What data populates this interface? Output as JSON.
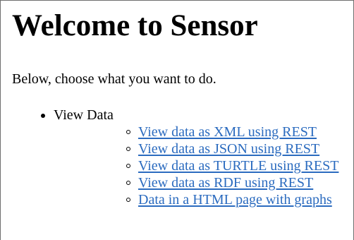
{
  "page": {
    "title": "Welcome to Sensor",
    "intro": "Below, choose what you want to do."
  },
  "menu": {
    "section_label": "View Data",
    "links": [
      {
        "label": "View data as XML using REST"
      },
      {
        "label": "View data as JSON using REST"
      },
      {
        "label": "View data as TURTLE using REST"
      },
      {
        "label": "View data as RDF using REST"
      },
      {
        "label": "Data in a HTML page with graphs"
      }
    ]
  },
  "colors": {
    "link": "#2b6bbf",
    "text": "#000000",
    "background": "#ffffff"
  }
}
